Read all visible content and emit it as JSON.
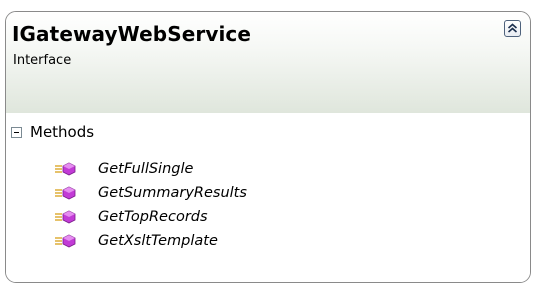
{
  "type": {
    "name": "IGatewayWebService",
    "kind": "Interface"
  },
  "sections": [
    {
      "label": "Methods",
      "expanded": true,
      "members": [
        {
          "name": "GetFullSingle",
          "icon": "method-icon"
        },
        {
          "name": "GetSummaryResults",
          "icon": "method-icon"
        },
        {
          "name": "GetTopRecords",
          "icon": "method-icon"
        },
        {
          "name": "GetXsltTemplate",
          "icon": "method-icon"
        }
      ]
    }
  ],
  "colors": {
    "border": "#8a8a8a",
    "header_gradient_top": "#ffffff",
    "header_gradient_bottom": "#dfe6dc",
    "method_icon_fill": "#c23bd6",
    "method_icon_lines": "#d9a21b"
  }
}
